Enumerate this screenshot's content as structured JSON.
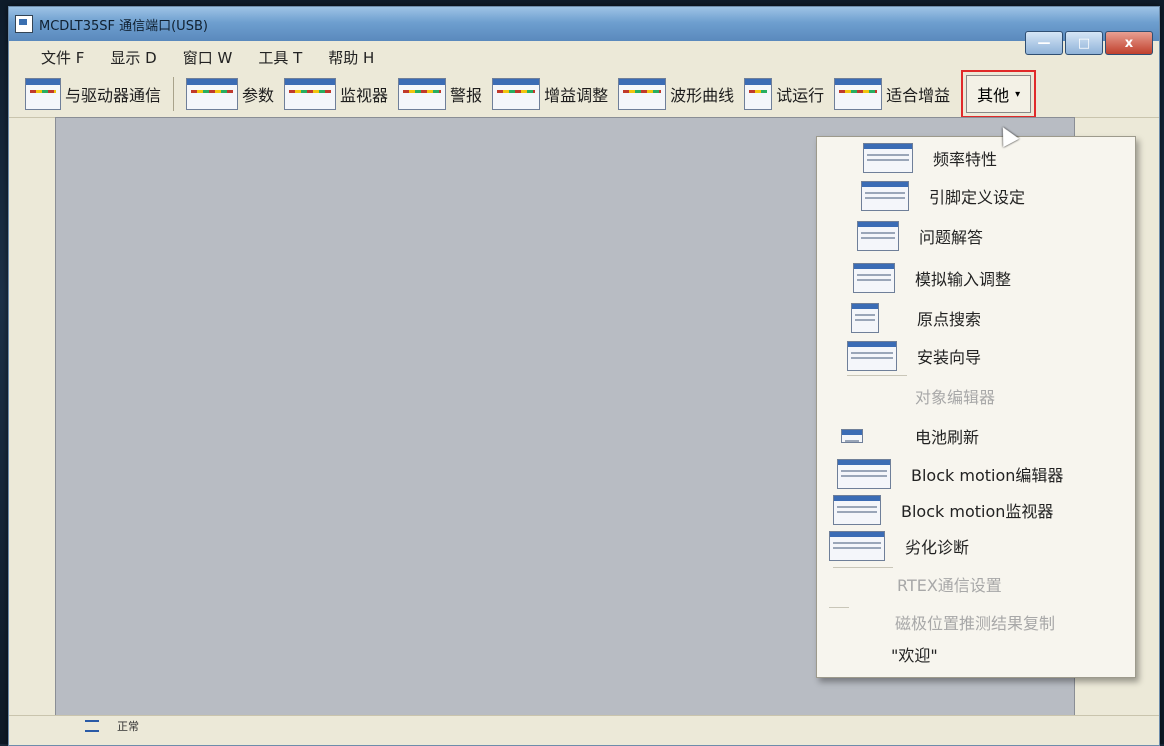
{
  "window": {
    "title": "MCDLT35SF 通信端口(USB)",
    "controls": {
      "minimize": "—",
      "maximize": "□",
      "close": "x"
    }
  },
  "menubar": {
    "items": [
      "文件 F",
      "显示 D",
      "窗口 W",
      "工具 T",
      "帮助 H"
    ]
  },
  "toolbar": {
    "items": [
      {
        "label": "与驱动器通信",
        "icon": "comm-icon"
      },
      {
        "label": "参数",
        "icon": "params-icon"
      },
      {
        "label": "监视器",
        "icon": "monitor-icon"
      },
      {
        "label": "警报",
        "icon": "alarm-icon"
      },
      {
        "label": "增益调整",
        "icon": "gain-adjust-icon"
      },
      {
        "label": "波形曲线",
        "icon": "waveform-icon"
      },
      {
        "label": "试运行",
        "icon": "test-run-icon"
      },
      {
        "label": "适合增益",
        "icon": "fit-gain-icon"
      }
    ],
    "other_label": "其他",
    "other_caret": "▾"
  },
  "dropdown": {
    "items": [
      {
        "label": "频率特性",
        "enabled": true,
        "icon": "frequency-icon"
      },
      {
        "label": "引脚定义设定",
        "enabled": true,
        "icon": "pin-definition-icon"
      },
      {
        "label": "问题解答",
        "enabled": true,
        "icon": "faq-icon"
      },
      {
        "label": "模拟输入调整",
        "enabled": true,
        "icon": "analog-input-icon"
      },
      {
        "label": "原点搜索",
        "enabled": true,
        "icon": "origin-search-icon"
      },
      {
        "label": "安装向导",
        "enabled": true,
        "icon": "install-wizard-icon"
      },
      {
        "label": "对象编辑器",
        "enabled": false,
        "icon": ""
      },
      {
        "label": "电池刷新",
        "enabled": true,
        "icon": "battery-icon"
      },
      {
        "label": "Block motion编辑器",
        "enabled": true,
        "icon": "block-editor-icon"
      },
      {
        "label": "Block motion监视器",
        "enabled": true,
        "icon": "block-monitor-icon"
      },
      {
        "label": "劣化诊断",
        "enabled": true,
        "icon": "diagnosis-icon"
      },
      {
        "label": "RTEX通信设置",
        "enabled": false,
        "icon": ""
      },
      {
        "label": "磁极位置推测结果复制",
        "enabled": false,
        "icon": ""
      },
      {
        "label": "\"欢迎\"",
        "enabled": true,
        "icon": ""
      }
    ]
  },
  "statusbar": {
    "text": "正常"
  },
  "colors": {
    "highlight_box": "#e02a2a",
    "client_bg": "#b8bcc3",
    "menu_bg": "#f7f5ee"
  }
}
